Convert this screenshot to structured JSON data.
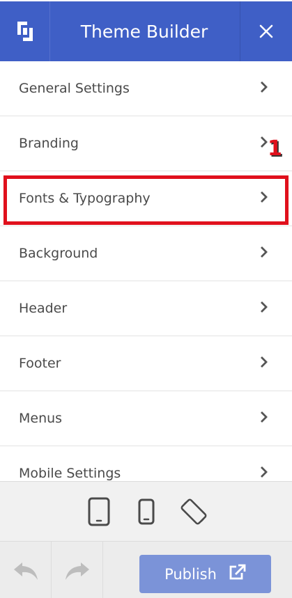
{
  "header": {
    "title": "Theme Builder",
    "logo_icon": "builder-logo-icon",
    "close_icon": "close-icon",
    "bg_color": "#3f5fc6"
  },
  "menu": {
    "items": [
      {
        "label": "General Settings"
      },
      {
        "label": "Branding"
      },
      {
        "label": "Fonts & Typography"
      },
      {
        "label": "Background"
      },
      {
        "label": "Header"
      },
      {
        "label": "Footer"
      },
      {
        "label": "Menus"
      },
      {
        "label": "Mobile Settings"
      }
    ],
    "chevron_icon": "chevron-right-icon"
  },
  "annotation": {
    "marker": "1",
    "highlight_color": "#e0101c",
    "highlighted_item": "Fonts & Typography"
  },
  "device_bar": {
    "icons": [
      "tablet-icon",
      "phone-icon",
      "rotate-icon"
    ]
  },
  "bottom_bar": {
    "undo_icon": "undo-icon",
    "redo_icon": "redo-icon",
    "publish_label": "Publish",
    "publish_icon": "external-link-icon",
    "publish_color": "#7b93d8"
  }
}
